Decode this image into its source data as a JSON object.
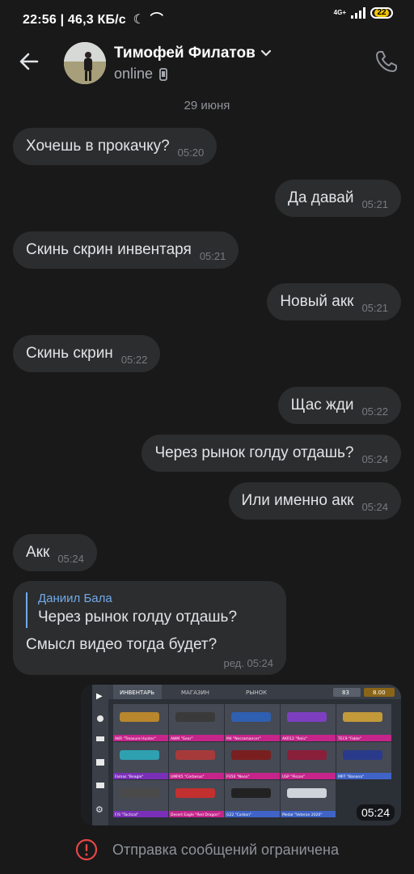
{
  "status_bar": {
    "text": "22:56 | 46,3 КБ/с",
    "network": "4G+",
    "battery": "22"
  },
  "header": {
    "name": "Тимофей Филатов",
    "status": "online"
  },
  "date_label": "29 июня",
  "messages": [
    {
      "text": "Хочешь в прокачку?",
      "time": "05:20",
      "dir": "in"
    },
    {
      "text": "Да давай",
      "time": "05:21",
      "dir": "out"
    },
    {
      "text": "Скинь скрин инвентаря",
      "time": "05:21",
      "dir": "in"
    },
    {
      "text": "Новый акк",
      "time": "05:21",
      "dir": "out"
    },
    {
      "text": "Скинь скрин",
      "time": "05:22",
      "dir": "in"
    },
    {
      "text": "Щас жди",
      "time": "05:22",
      "dir": "out"
    },
    {
      "text": "Через рынок голду отдашь?",
      "time": "05:24",
      "dir": "out"
    },
    {
      "text": "Или именно акк",
      "time": "05:24",
      "dir": "out"
    },
    {
      "text": "Акк",
      "time": "05:24",
      "dir": "in"
    }
  ],
  "reply_message": {
    "quote_author": "Даниил Бала",
    "quote_text": "Через рынок голду отдашь?",
    "text": "Смысл видео тогда будет?",
    "time": "ред. 05:24"
  },
  "photo_message": {
    "time": "05:24",
    "game": {
      "tabs": [
        "ИНВЕНТАРЬ",
        "МАГАЗИН",
        "РЫНОК"
      ],
      "currency": [
        "83",
        "8.00"
      ],
      "items": [
        "AKR \"Treasure Hunter\"",
        "AWM \"Gear\"",
        "M4 \"Necromancer\"",
        "AKR12 \"Relic\"",
        "TEC9 \"Fable\"",
        "Famas \"Beagle\"",
        "UMP45 \"Cerberus\"",
        "P350 \"Neon\"",
        "USP \"Pisces\"",
        "MP7 \"Banana\"",
        "F/S \"Tactical\"",
        "Desert Eagle \"Red Dragon\"",
        "G22 \"Carbon\"",
        "Medal \"Veteran 2020\""
      ],
      "label_colors": [
        "#c5258b",
        "#c5258b",
        "#c5258b",
        "#c5258b",
        "#c5258b",
        "#7a2fb8",
        "#c5258b",
        "#c5258b",
        "#c5258b",
        "#3f63c7",
        "#7a2fb8",
        "#c5258b",
        "#3f63c7",
        "#3f63c7"
      ]
    }
  },
  "footer": {
    "text": "Отправка сообщений ограничена"
  },
  "colors": {
    "background": "#19191a",
    "bubble": "#2c2d2e",
    "accent": "#71aaeb",
    "warning": "#e64646"
  },
  "icons": [
    "back-arrow-icon",
    "chevron-down-icon",
    "phone-icon",
    "device-icon",
    "warning-icon"
  ]
}
